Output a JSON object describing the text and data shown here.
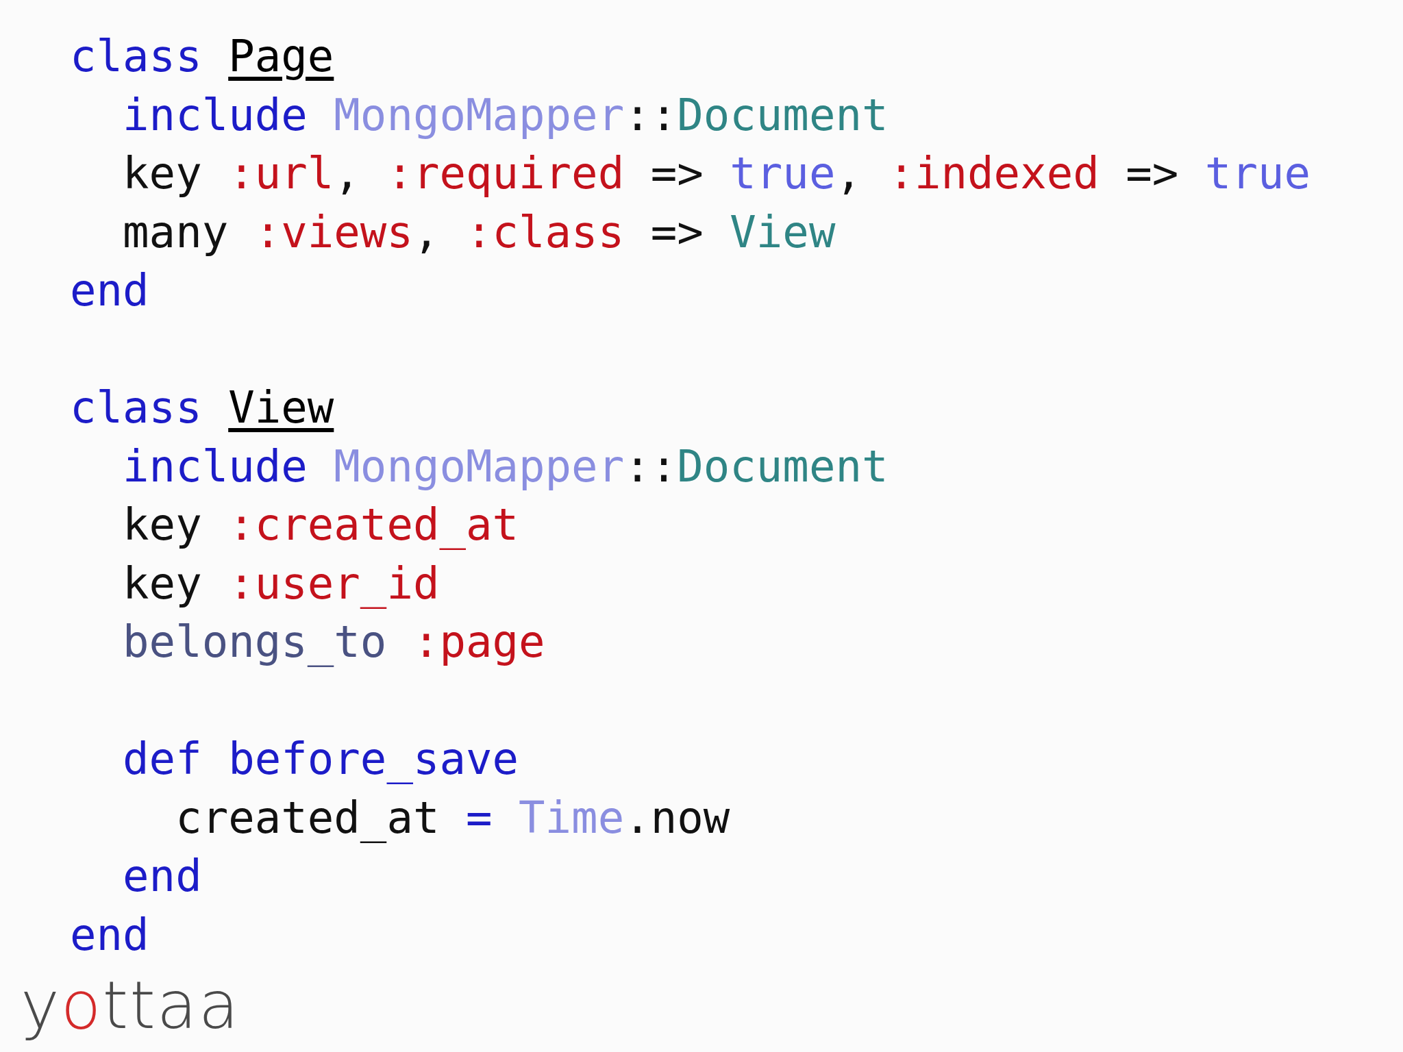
{
  "code_lines": [
    {
      "kind": "code",
      "tokens": [
        {
          "kind": "keyword",
          "text": "class "
        },
        {
          "kind": "classname",
          "text": "Page"
        }
      ]
    },
    {
      "kind": "code",
      "tokens": [
        {
          "kind": "keyword",
          "text": "  include "
        },
        {
          "kind": "module",
          "text": "MongoMapper"
        },
        {
          "kind": "plain",
          "text": "::"
        },
        {
          "kind": "constant",
          "text": "Document"
        }
      ]
    },
    {
      "kind": "code",
      "tokens": [
        {
          "kind": "plain",
          "text": "  key "
        },
        {
          "kind": "symbol",
          "text": ":url"
        },
        {
          "kind": "plain",
          "text": ", "
        },
        {
          "kind": "symbol",
          "text": ":required"
        },
        {
          "kind": "plain",
          "text": " => "
        },
        {
          "kind": "boolean",
          "text": "true"
        },
        {
          "kind": "plain",
          "text": ", "
        },
        {
          "kind": "symbol",
          "text": ":indexed"
        },
        {
          "kind": "plain",
          "text": " => "
        },
        {
          "kind": "boolean",
          "text": "true"
        }
      ]
    },
    {
      "kind": "code",
      "tokens": [
        {
          "kind": "plain",
          "text": "  many "
        },
        {
          "kind": "symbol",
          "text": ":views"
        },
        {
          "kind": "plain",
          "text": ", "
        },
        {
          "kind": "symbol",
          "text": ":class"
        },
        {
          "kind": "plain",
          "text": " => "
        },
        {
          "kind": "constant",
          "text": "View"
        }
      ]
    },
    {
      "kind": "code",
      "tokens": [
        {
          "kind": "keyword",
          "text": "end"
        }
      ]
    },
    {
      "kind": "blank"
    },
    {
      "kind": "code",
      "tokens": [
        {
          "kind": "keyword",
          "text": "class "
        },
        {
          "kind": "classname",
          "text": "View"
        }
      ]
    },
    {
      "kind": "code",
      "tokens": [
        {
          "kind": "keyword",
          "text": "  include "
        },
        {
          "kind": "module",
          "text": "MongoMapper"
        },
        {
          "kind": "plain",
          "text": "::"
        },
        {
          "kind": "constant",
          "text": "Document"
        }
      ]
    },
    {
      "kind": "code",
      "tokens": [
        {
          "kind": "plain",
          "text": "  key "
        },
        {
          "kind": "symbol",
          "text": ":created_at"
        }
      ]
    },
    {
      "kind": "code",
      "tokens": [
        {
          "kind": "plain",
          "text": "  key "
        },
        {
          "kind": "symbol",
          "text": ":user_id"
        }
      ]
    },
    {
      "kind": "code",
      "tokens": [
        {
          "kind": "method",
          "text": "  belongs_to "
        },
        {
          "kind": "symbol",
          "text": ":page"
        }
      ]
    },
    {
      "kind": "blank"
    },
    {
      "kind": "code",
      "tokens": [
        {
          "kind": "keyword",
          "text": "  def before_save"
        }
      ]
    },
    {
      "kind": "code",
      "tokens": [
        {
          "kind": "plain",
          "text": "    created_at "
        },
        {
          "kind": "operator",
          "text": "= "
        },
        {
          "kind": "module",
          "text": "Time"
        },
        {
          "kind": "plain",
          "text": ".now"
        }
      ]
    },
    {
      "kind": "code",
      "tokens": [
        {
          "kind": "keyword",
          "text": "  end"
        }
      ]
    },
    {
      "kind": "code",
      "tokens": [
        {
          "kind": "keyword",
          "text": "end"
        }
      ]
    }
  ],
  "logo": {
    "parts": [
      {
        "text": "y",
        "accent": false
      },
      {
        "text": "o",
        "accent": true
      },
      {
        "text": "ttaa",
        "accent": false
      }
    ]
  }
}
